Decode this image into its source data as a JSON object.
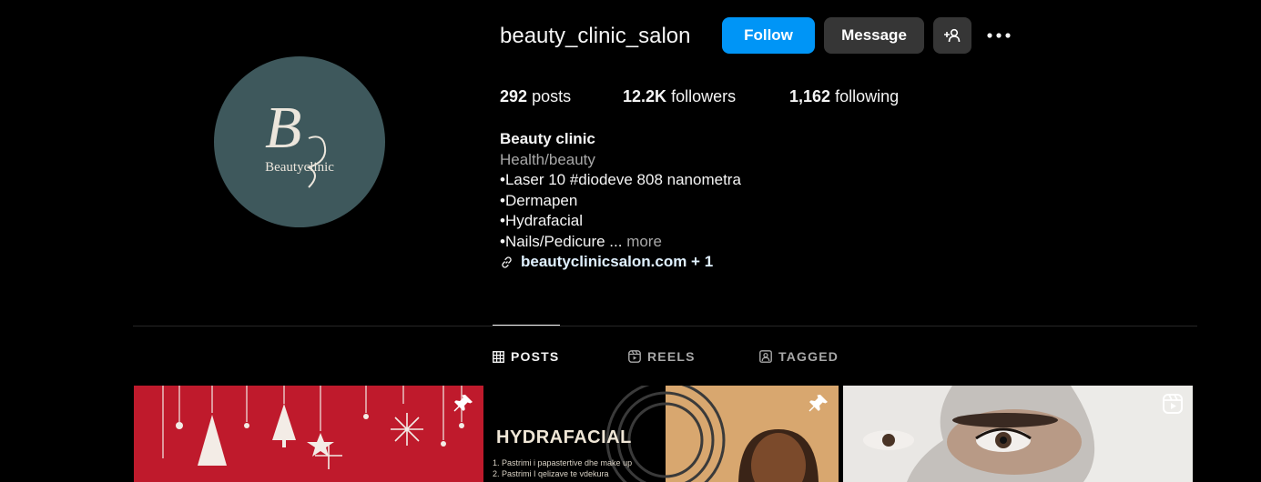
{
  "profile": {
    "username": "beauty_clinic_salon",
    "avatar_text": "Beautyclinic",
    "avatar_monogram": "B",
    "avatar_color": "#3e585c"
  },
  "actions": {
    "follow_label": "Follow",
    "message_label": "Message",
    "follow_color": "#0095f6",
    "suggest_icon": "person-plus-icon",
    "more_icon": "more-options-icon"
  },
  "stats": {
    "posts_count": "292",
    "posts_label": "posts",
    "followers_count": "12.2K",
    "followers_label": "followers",
    "following_count": "1,162",
    "following_label": "following"
  },
  "bio": {
    "name": "Beauty clinic",
    "category": "Health/beauty",
    "lines": [
      "•Laser 10 #diodeve 808 nanometra",
      "•Dermapen",
      "•Hydrafacial"
    ],
    "last_line": "•Nails/Pedicure ...",
    "more_label": "more",
    "link_text": "beautyclinicsalon.com + 1",
    "link_icon": "link-icon"
  },
  "tabs": [
    {
      "label": "POSTS",
      "icon": "grid-icon",
      "active": true
    },
    {
      "label": "REELS",
      "icon": "reels-icon",
      "active": false
    },
    {
      "label": "TAGGED",
      "icon": "tagged-icon",
      "active": false
    }
  ],
  "posts": [
    {
      "badge": "pin-icon",
      "background": "#bf1a2c"
    },
    {
      "badge": "pin-icon",
      "title": "HYDRAFACIAL",
      "lines": [
        "1. Pastrimi i papastertive dhe make up",
        "2. Pastrimi I qelizave te vdekura"
      ]
    },
    {
      "badge": "reel-icon",
      "background": "#bdb8b4"
    }
  ]
}
